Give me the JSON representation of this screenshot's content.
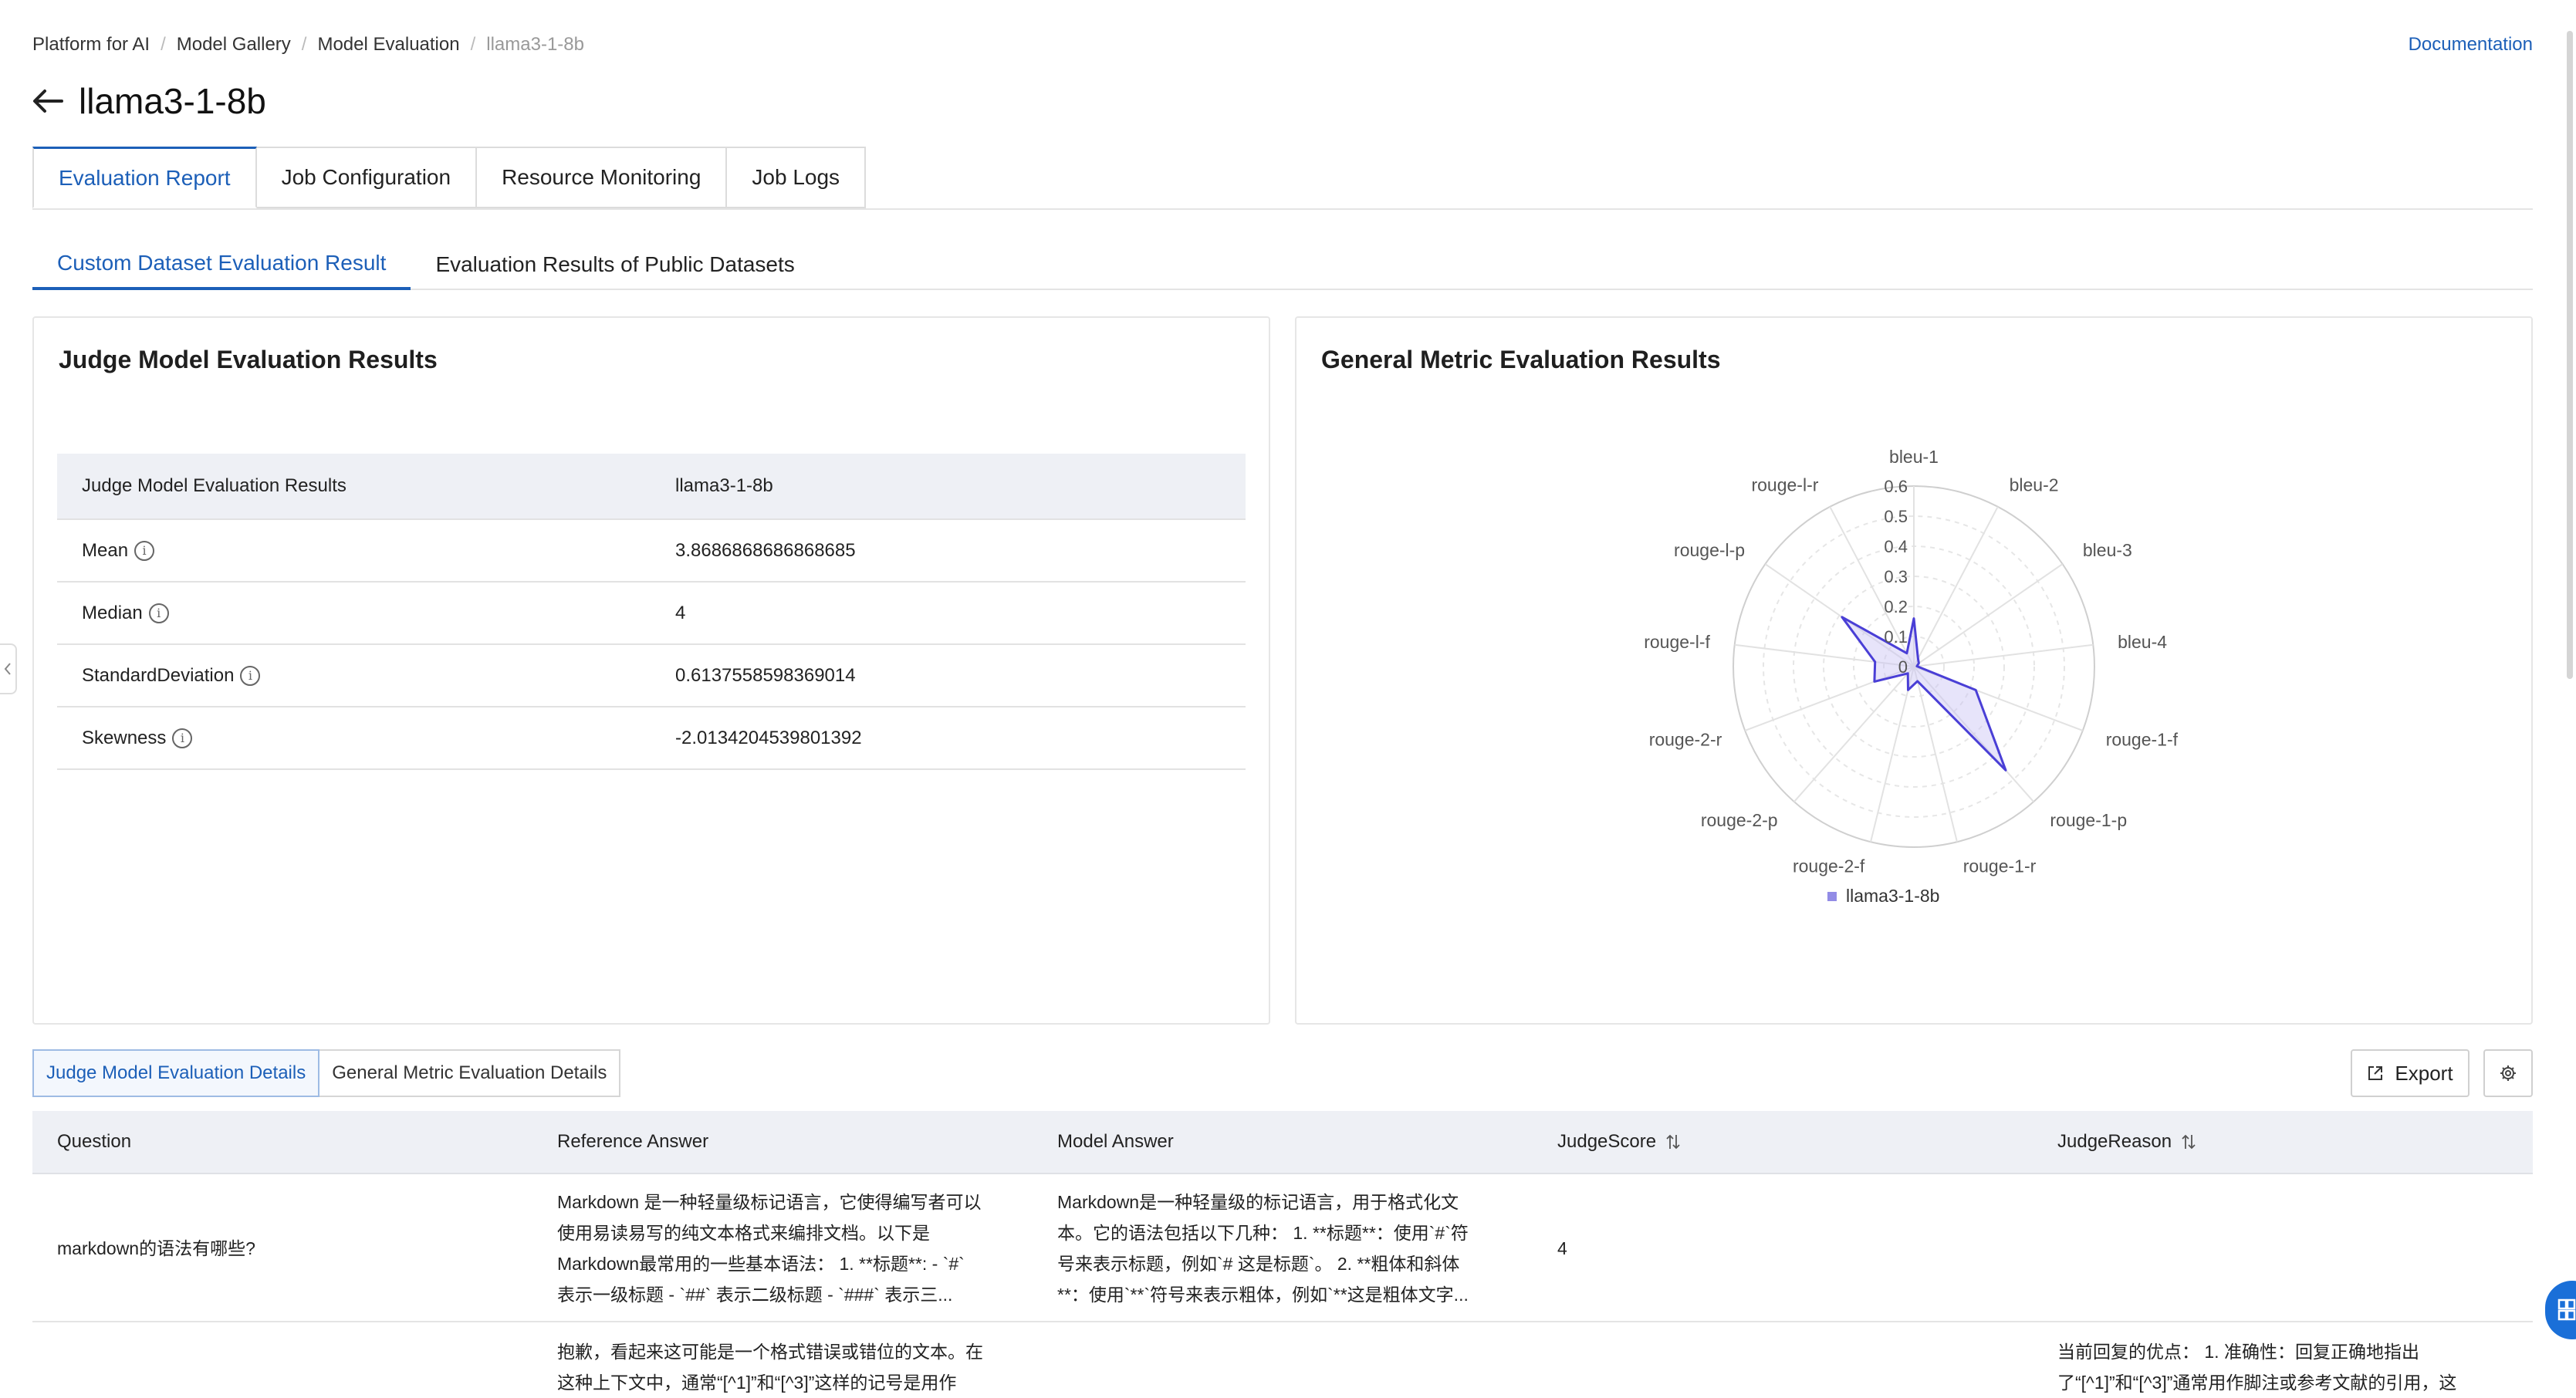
{
  "breadcrumb": {
    "items": [
      "Platform for AI",
      "Model Gallery",
      "Model Evaluation"
    ],
    "current": "llama3-1-8b",
    "separator": "/"
  },
  "header": {
    "documentation": "Documentation",
    "title": "llama3-1-8b"
  },
  "tabs": [
    "Evaluation Report",
    "Job Configuration",
    "Resource Monitoring",
    "Job Logs"
  ],
  "subtabs": [
    "Custom Dataset Evaluation Result",
    "Evaluation Results of Public Datasets"
  ],
  "judge_card": {
    "title": "Judge Model Evaluation Results",
    "table": {
      "header": [
        "Judge Model Evaluation Results",
        "llama3-1-8b"
      ],
      "rows": [
        {
          "metric": "Mean",
          "value": "3.8686868686868685"
        },
        {
          "metric": "Median",
          "value": "4"
        },
        {
          "metric": "StandardDeviation",
          "value": "0.6137558598369014"
        },
        {
          "metric": "Skewness",
          "value": "-2.0134204539801392"
        }
      ]
    }
  },
  "general_card": {
    "title": "General Metric Evaluation Results"
  },
  "chart_data": {
    "type": "radar",
    "axes": [
      "bleu-1",
      "bleu-2",
      "bleu-3",
      "bleu-4",
      "rouge-1-f",
      "rouge-1-p",
      "rouge-1-r",
      "rouge-2-f",
      "rouge-2-p",
      "rouge-2-r",
      "rouge-l-f",
      "rouge-l-p",
      "rouge-l-r"
    ],
    "ticks": [
      "0",
      "0.1",
      "0.2",
      "0.3",
      "0.4",
      "0.5",
      "0.6"
    ],
    "range": [
      0,
      0.6
    ],
    "series": [
      {
        "name": "llama3-1-8b",
        "values": [
          0.16,
          0.03,
          0.02,
          0.01,
          0.22,
          0.46,
          0.05,
          0.08,
          0.03,
          0.14,
          0.13,
          0.29,
          0.05
        ]
      }
    ],
    "legend_position": "bottom",
    "colors": {
      "line": "#4a3fd6",
      "fill": "#c9c4f5"
    }
  },
  "details": {
    "toggle": [
      "Judge Model Evaluation Details",
      "General Metric Evaluation Details"
    ],
    "export_label": "Export",
    "columns": [
      "Question",
      "Reference Answer",
      "Model Answer",
      "JudgeScore",
      "JudgeReason"
    ],
    "rows": [
      {
        "question": "markdown的语法有哪些?",
        "reference": [
          "Markdown 是一种轻量级标记语言，它使得编写者可以",
          "使用易读易写的纯文本格式来编排文档。以下是",
          "Markdown最常用的一些基本语法： 1. **标题**: - `#`",
          "表示一级标题 - `##` 表示二级标题 - `###` 表示三..."
        ],
        "model": [
          "Markdown是一种轻量级的标记语言，用于格式化文",
          "本。它的语法包括以下几种： 1. **标题**：使用`#`符",
          "号来表示标题，例如`# 这是标题`。 2. **粗体和斜体",
          "**：使用`**`符号来表示粗体，例如`**这是粗体文字..."
        ],
        "score": "4",
        "reason": []
      },
      {
        "question": "",
        "reference": [
          "抱歉，看起来这可能是一个格式错误或错位的文本。在",
          "这种上下文中，通常“[^1]”和“[^3]”这样的记号是用作"
        ],
        "model": [],
        "score": "",
        "reason": [
          "当前回复的优点： 1. 准确性：回复正确地指出",
          "了“[^1]”和“[^3]”通常用作脚注或参考文献的引用，这"
        ]
      }
    ]
  }
}
